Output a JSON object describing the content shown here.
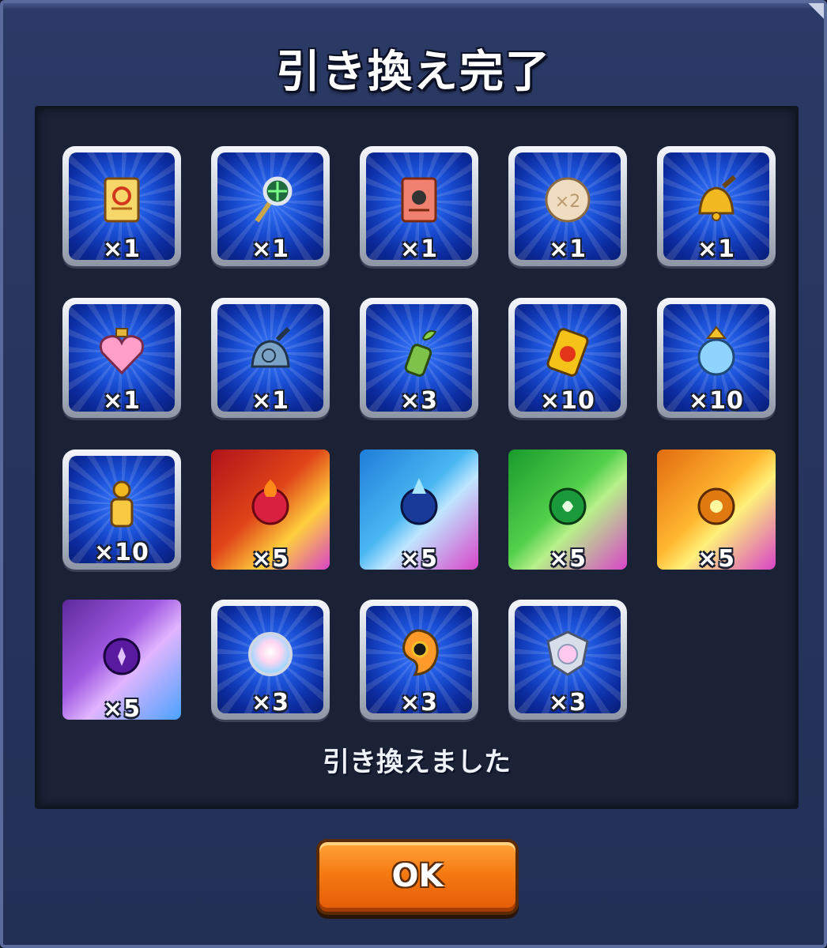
{
  "dialog": {
    "title": "引き換え完了",
    "message": "引き換えました",
    "ok_label": "OK"
  },
  "items": [
    {
      "icon": "gold-scroll-icon",
      "qty": "×1",
      "frame": "silver"
    },
    {
      "icon": "magnifier-wand-icon",
      "qty": "×1",
      "frame": "silver"
    },
    {
      "icon": "red-scroll-icon",
      "qty": "×1",
      "frame": "silver"
    },
    {
      "icon": "x2-cookie-icon",
      "qty": "×1",
      "frame": "silver"
    },
    {
      "icon": "gold-bell-icon",
      "qty": "×1",
      "frame": "silver"
    },
    {
      "icon": "heart-potion-icon",
      "qty": "×1",
      "frame": "silver"
    },
    {
      "icon": "clock-bell-icon",
      "qty": "×1",
      "frame": "silver"
    },
    {
      "icon": "sprout-bottle-icon",
      "qty": "×3",
      "frame": "silver"
    },
    {
      "icon": "fire-can-icon",
      "qty": "×10",
      "frame": "silver"
    },
    {
      "icon": "wing-jar-icon",
      "qty": "×10",
      "frame": "silver"
    },
    {
      "icon": "gold-pawn-icon",
      "qty": "×10",
      "frame": "silver"
    },
    {
      "icon": "fire-egg-icon",
      "qty": "×5",
      "frame": "red"
    },
    {
      "icon": "water-egg-icon",
      "qty": "×5",
      "frame": "blue"
    },
    {
      "icon": "wood-egg-icon",
      "qty": "×5",
      "frame": "green"
    },
    {
      "icon": "light-egg-icon",
      "qty": "×5",
      "frame": "yellow"
    },
    {
      "icon": "dark-egg-icon",
      "qty": "×5",
      "frame": "purple"
    },
    {
      "icon": "rainbow-orb-icon",
      "qty": "×3",
      "frame": "silver"
    },
    {
      "icon": "rainbow-soul-icon",
      "qty": "×3",
      "frame": "silver"
    },
    {
      "icon": "rainbow-crest-icon",
      "qty": "×3",
      "frame": "silver"
    }
  ],
  "colors": {
    "ok_button": "#f57a12",
    "panel": "#1b2236",
    "dialog": "#2b3a66"
  }
}
